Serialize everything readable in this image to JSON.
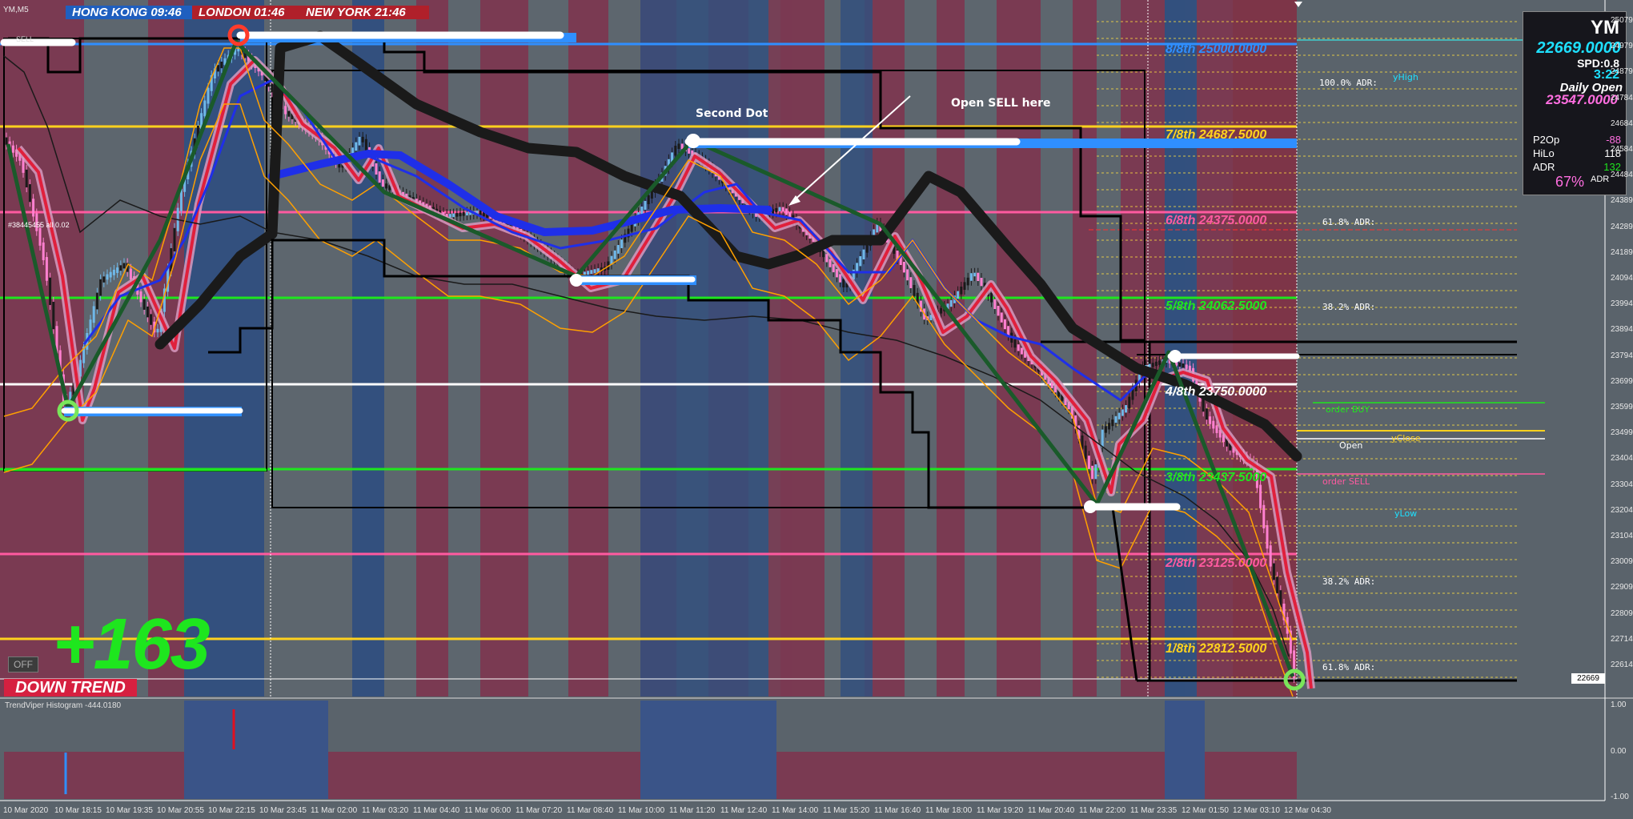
{
  "window": {
    "symbol_label": "YM,M5"
  },
  "sessions": {
    "hong_kong": "HONG KONG 09:46",
    "london": "LONDON 01:46",
    "new_york": "NEW YORK 21:46"
  },
  "info_panel": {
    "symbol": "YM",
    "price": "22669.0000",
    "spread": "SPD:0.8",
    "countdown": "3:22",
    "daily_open_label": "Daily Open",
    "daily_open_value": "23547.0000",
    "stats": [
      {
        "label": "P2Op",
        "value": "-88",
        "color": "#ff6ee0"
      },
      {
        "label": "HiLo",
        "value": "118",
        "color": "#ffffff"
      },
      {
        "label": "ADR",
        "value": "132",
        "color": "#1ee61e"
      }
    ],
    "adr_percent": "67%",
    "adr_percent_label": "ADR"
  },
  "annotations": {
    "second_dot": "Second Dot",
    "open_sell": "Open SELL here",
    "profit": "+163",
    "trend": "DOWN TREND",
    "off_button": "OFF",
    "sell_tag": "SELL"
  },
  "murrey_levels": [
    {
      "label": "8/8th  25000.0000",
      "color": "#2f8fff"
    },
    {
      "label": "7/8th  24687.5000",
      "color": "#ffd21e"
    },
    {
      "label": "6/8th  24375.0000",
      "color": "#ff5aa0"
    },
    {
      "label": "5/8th  24062.5000",
      "color": "#1ee61e"
    },
    {
      "label": "4/8th  23750.0000",
      "color": "#ffffff"
    },
    {
      "label": "3/8th  23437.5000",
      "color": "#1ee61e"
    },
    {
      "label": "2/8th  23125.0000",
      "color": "#ff5aa0"
    },
    {
      "label": "1/8th  22812.5000",
      "color": "#ffd21e"
    }
  ],
  "adr_labels": [
    "100.0% ADR:",
    "61.8% ADR:",
    "38.2% ADR:",
    "38.2% ADR:",
    "61.8% ADR:"
  ],
  "side_labels": {
    "yhigh": "yHigh",
    "order_buy": "order BUY",
    "yclose": "yClose",
    "open": "Open",
    "order_sell": "order SELL",
    "ylow": "yLow"
  },
  "indicator_label": "#38445455  all 0.02",
  "subwindow": {
    "title": "TrendViper Histogram -444.0180",
    "axis": [
      "1.00",
      "0.00",
      "-1.00"
    ]
  },
  "price_axis": [
    "25079",
    "24979",
    "24879",
    "24784",
    "24684",
    "24584",
    "24484",
    "24389",
    "24289",
    "24189",
    "24094",
    "23994",
    "23894",
    "23794",
    "23699",
    "23599",
    "23499",
    "23404",
    "23304",
    "23204",
    "23104",
    "23009",
    "22909",
    "22809",
    "22714",
    "22614"
  ],
  "current_price_tag": "22669",
  "time_axis": [
    "10 Mar 2020",
    "10 Mar 18:15",
    "10 Mar 19:35",
    "10 Mar 20:55",
    "10 Mar 22:15",
    "10 Mar 23:45",
    "11 Mar 02:00",
    "11 Mar 03:20",
    "11 Mar 04:40",
    "11 Mar 06:00",
    "11 Mar 07:20",
    "11 Mar 08:40",
    "11 Mar 10:00",
    "11 Mar 11:20",
    "11 Mar 12:40",
    "11 Mar 14:00",
    "11 Mar 15:20",
    "11 Mar 16:40",
    "11 Mar 18:00",
    "11 Mar 19:20",
    "11 Mar 20:40",
    "11 Mar 22:00",
    "11 Mar 23:35",
    "12 Mar 01:50",
    "12 Mar 03:10",
    "12 Mar 04:30"
  ],
  "colors": {
    "bg": "#5a636b",
    "session_red": "#7a3a52",
    "session_blue": "#33507e",
    "bull": "#6fb8e8",
    "bear": "#ff80d0",
    "ma_red": "#e0203c",
    "ma_blue": "#1f2fe8",
    "accent_cyan": "#1ee0ff"
  },
  "chart_data": {
    "type": "candlestick",
    "x": [
      "10 Mar 2020",
      "10 Mar 18:15",
      "10 Mar 19:35",
      "10 Mar 20:55",
      "10 Mar 22:15",
      "10 Mar 23:45",
      "11 Mar 02:00",
      "11 Mar 03:20",
      "11 Mar 04:40",
      "11 Mar 06:00",
      "11 Mar 07:20",
      "11 Mar 08:40",
      "11 Mar 10:00",
      "11 Mar 11:20",
      "11 Mar 12:40",
      "11 Mar 14:00",
      "11 Mar 15:20",
      "11 Mar 16:40",
      "11 Mar 18:00",
      "11 Mar 19:20",
      "11 Mar 20:40",
      "11 Mar 22:00",
      "11 Mar 23:35",
      "12 Mar 01:50",
      "12 Mar 03:10",
      "12 Mar 04:30"
    ],
    "series": [
      {
        "name": "YM,M5",
        "values": [
          24480,
          23650,
          24150,
          24700,
          24950,
          24700,
          24600,
          24450,
          24380,
          24380,
          24300,
          24180,
          24300,
          24600,
          24420,
          24300,
          24150,
          24100,
          23900,
          23800,
          23600,
          23300,
          23700,
          23700,
          23200,
          22669
        ]
      }
    ],
    "ylim": [
      22614,
      25079
    ],
    "grid": false
  }
}
